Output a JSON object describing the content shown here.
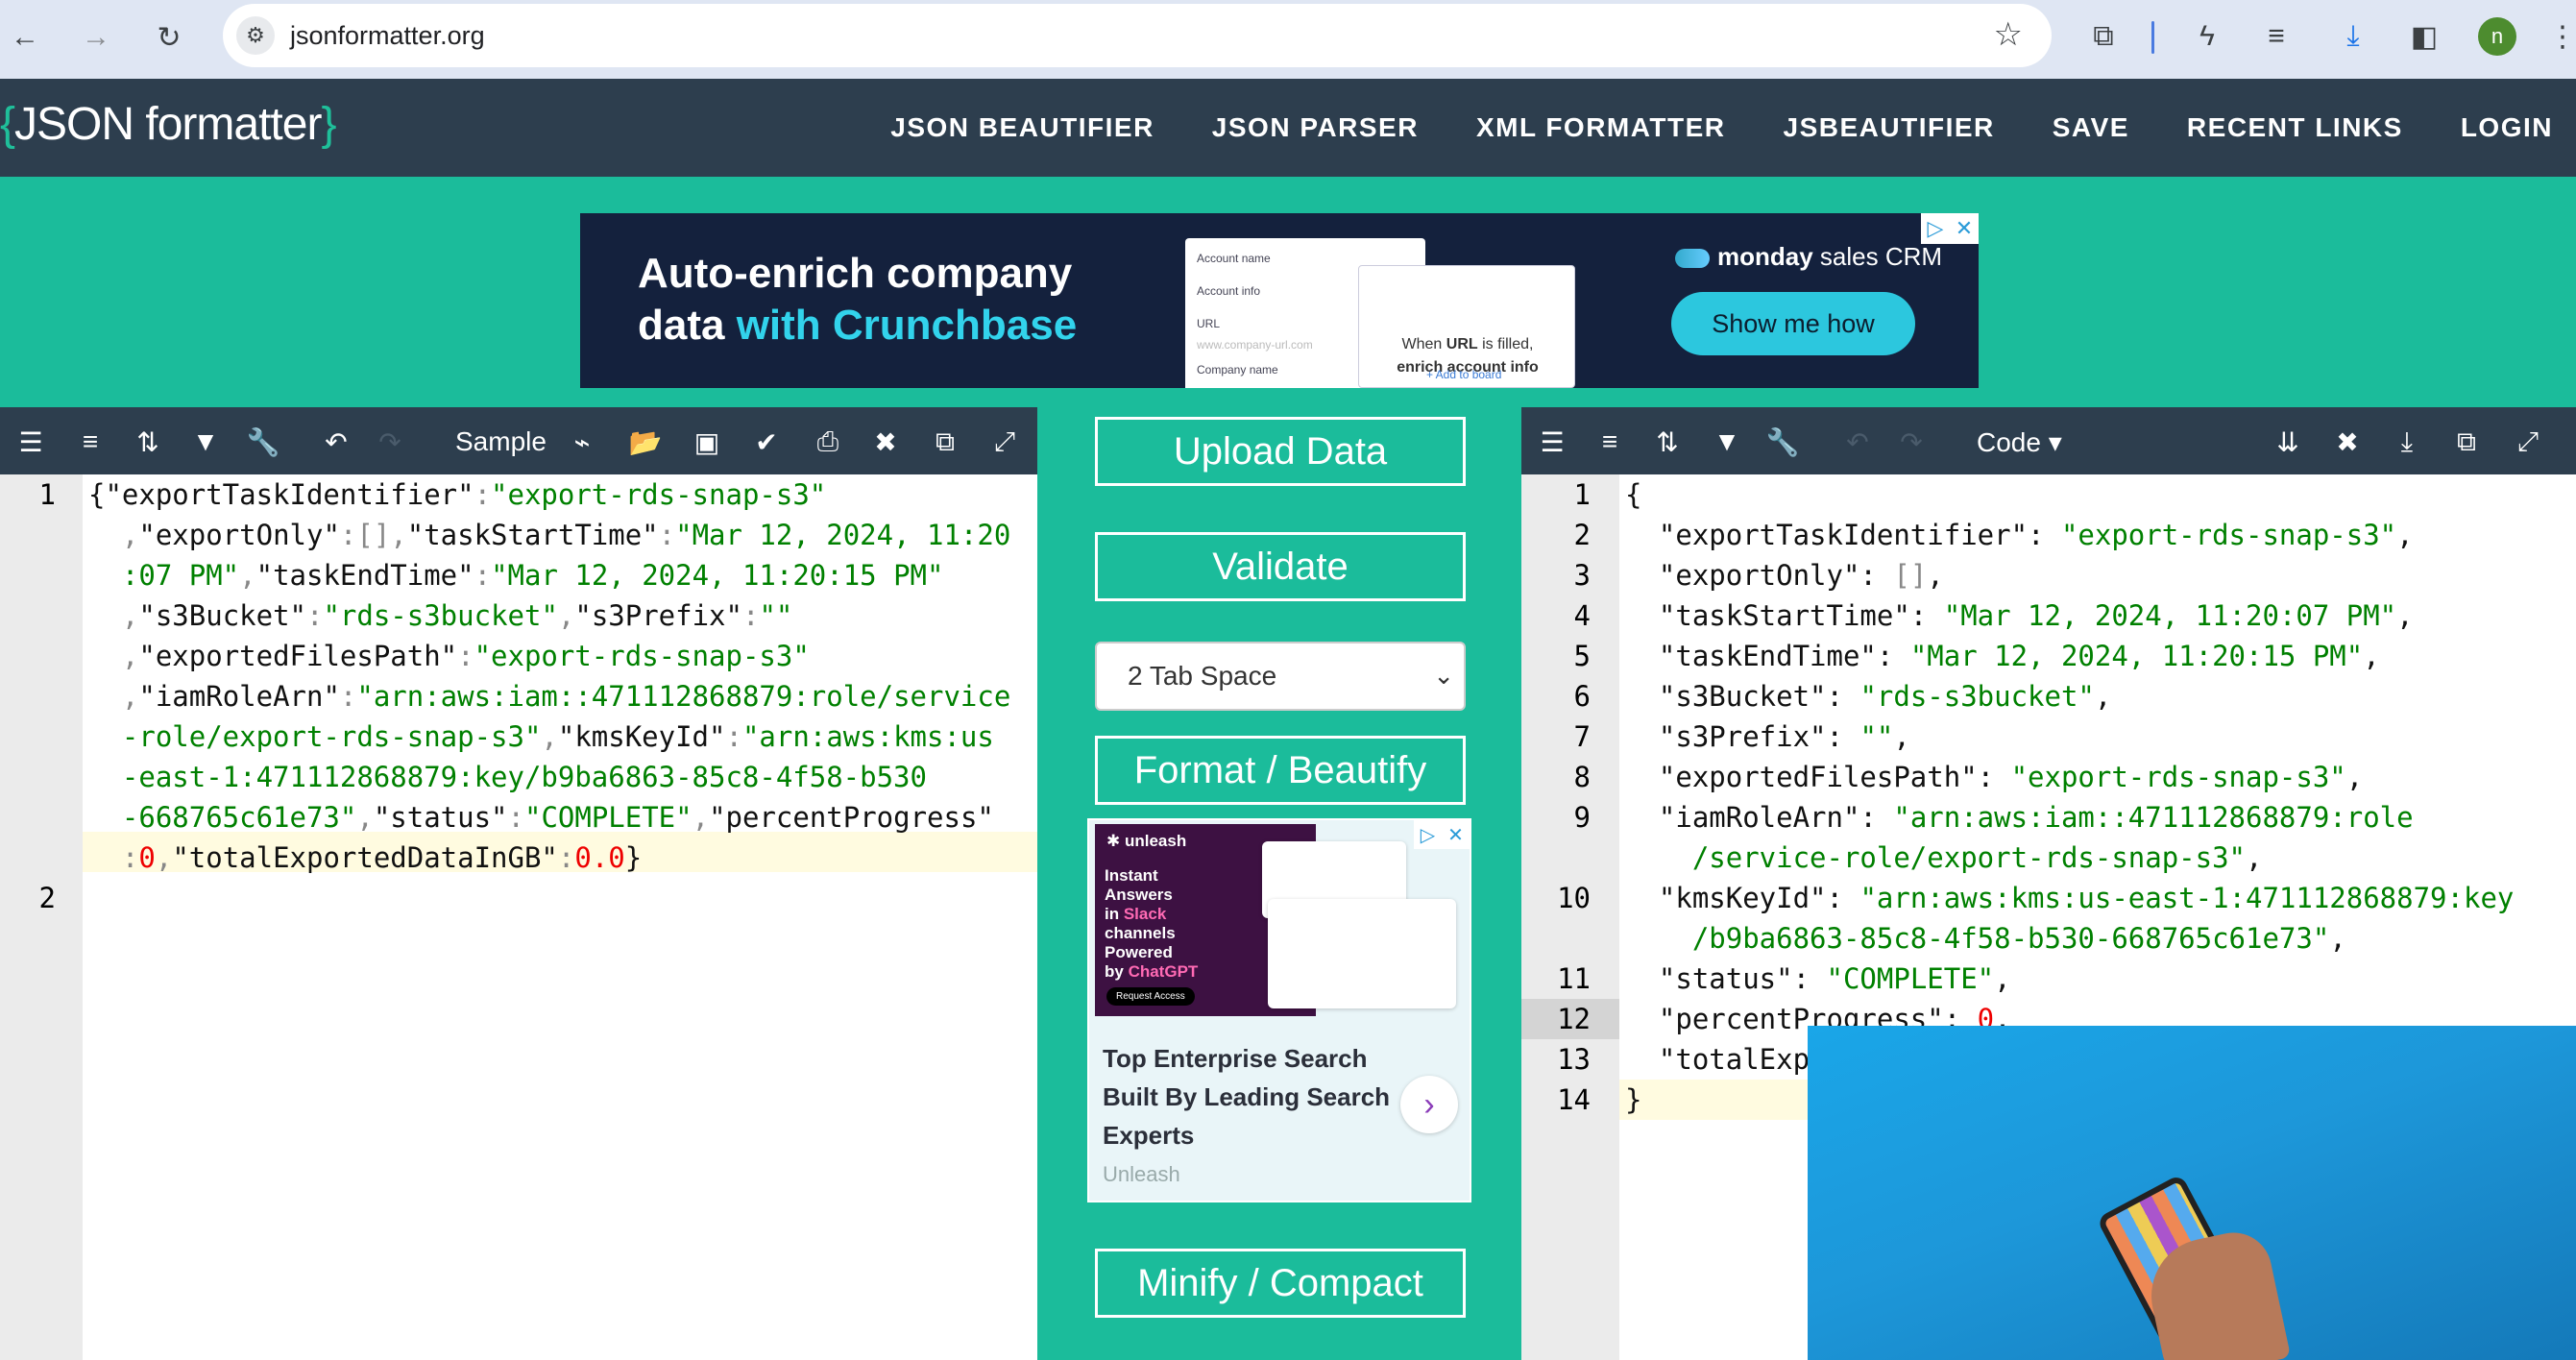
{
  "browser": {
    "url": "jsonformatter.org",
    "avatar_letter": "n"
  },
  "site": {
    "logo_text": "JSON formatter",
    "logo_open": "{",
    "logo_close": "}",
    "nav": [
      "JSON BEAUTIFIER",
      "JSON PARSER",
      "XML FORMATTER",
      "JSBEAUTIFIER",
      "SAVE",
      "RECENT LINKS",
      "LOGIN"
    ]
  },
  "banner_ad": {
    "headline_1": "Auto-enrich company",
    "headline_2a": "data ",
    "headline_2b": "with Crunchbase",
    "mock_fields": [
      "Account name",
      "Account info",
      "URL",
      "www.company-url.com",
      "Company name"
    ],
    "mock_card_1": "When ",
    "mock_card_bold": "URL",
    "mock_card_2": " is filled,",
    "mock_card_3": "enrich account info",
    "mock_card_link": "+ Add to board",
    "brand_bold": "monday",
    "brand_rest": " sales CRM",
    "cta": "Show me how"
  },
  "left_editor": {
    "sample_label": "Sample",
    "line_numbers": [
      "1",
      "2"
    ]
  },
  "right_editor": {
    "code_label": "Code ▾",
    "line_numbers": [
      "1",
      "2",
      "3",
      "4",
      "5",
      "6",
      "7",
      "8",
      "9",
      "10",
      "11",
      "12",
      "13",
      "14"
    ]
  },
  "center": {
    "upload": "Upload Data",
    "validate": "Validate",
    "indent_select": "2 Tab Space",
    "format": "Format / Beautify",
    "minify": "Minify / Compact"
  },
  "square_ad": {
    "brand": "✱ unleash",
    "text_1": "Instant",
    "text_2": "Answers",
    "text_3": "in ",
    "text_3b": "Slack",
    "text_4": "channels",
    "text_5": "Powered",
    "text_6": "by ",
    "text_6b": "ChatGPT",
    "cta_small": "Request Access",
    "headline": "Top Enterprise Search Built By Leading Search Experts",
    "source": "Unleash"
  },
  "colors": {
    "page_bg": "#1bbc9b",
    "header_bg": "#2d3e4e",
    "string": "#008000",
    "number": "#ee0000"
  }
}
